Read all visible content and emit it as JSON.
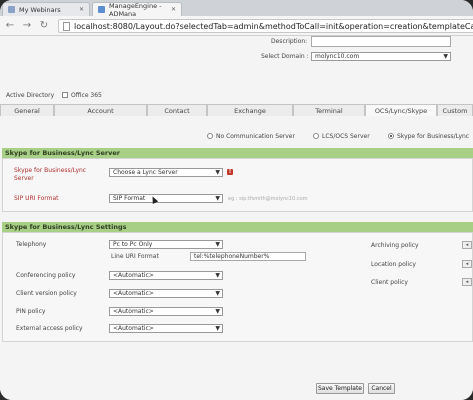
{
  "browser": {
    "tabs": [
      {
        "label": "My Webinars"
      },
      {
        "label": "ManageEngine - ADMana"
      }
    ],
    "url": "localhost:8080/Layout.do?selectedTab=admin&methodToCall=init&operation=creation&templateCatego"
  },
  "form": {
    "description_label": "Description:",
    "description_value": "",
    "domain_label": "Select Domain :",
    "domain_value": "molync10.com"
  },
  "directory": {
    "active_directory_label": "Active Directory",
    "office365_label": "Office 365"
  },
  "tabs": [
    {
      "label": "General"
    },
    {
      "label": "Account"
    },
    {
      "label": "Contact"
    },
    {
      "label": "Exchange"
    },
    {
      "label": "Terminal"
    },
    {
      "label": "OCS/Lync/Skype"
    },
    {
      "label": "Custom"
    }
  ],
  "server_options": {
    "no_comm": "No Communication Server",
    "lcs_ocs": "LCS/OCS Server",
    "skype": "Skype for Business/Lync"
  },
  "server_section": {
    "title": "Skype for Business/Lync Server",
    "server_label": "Skype for Business/Lync Server",
    "server_value": "Choose a Lync Server",
    "sip_label": "SIP URI Format",
    "sip_value": "SIP Format",
    "sip_hint": "eg : sip:tfsmith@molync10.com",
    "error_badge": "!"
  },
  "settings_section": {
    "title": "Skype for Business/Lync Settings",
    "telephony_label": "Telephony",
    "telephony_value": "Pc to Pc Only",
    "line_uri_label": "Line URI Format",
    "line_uri_value": "tel:%telephoneNumber%",
    "conferencing_label": "Conferencing policy",
    "conferencing_value": "<Automatic>",
    "client_version_label": "Client version policy",
    "client_version_value": "<Automatic>",
    "pin_label": "PIN policy",
    "pin_value": "<Automatic>",
    "external_label": "External access policy",
    "external_value": "<Automatic>",
    "archiving_label": "Archiving policy",
    "location_label": "Location policy",
    "client_label": "Client policy"
  },
  "buttons": {
    "save": "Save Template",
    "cancel": "Cancel"
  }
}
